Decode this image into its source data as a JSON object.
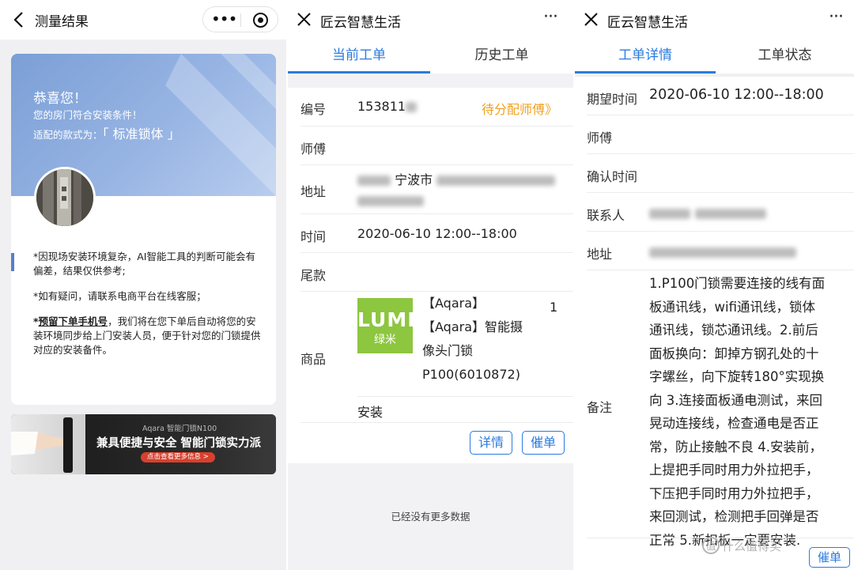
{
  "panel1": {
    "title": "测量结果",
    "congrats": "恭喜您！",
    "line1": "您的房门符合安装条件！",
    "line2_prefix": "适配的款式为：",
    "line2_value": "「 标准锁体 」",
    "note1": "*因现场安装环境复杂，AI智能工具的判断可能会有偏差，结果仅供参考;",
    "note2": "*如有疑问，请联系电商平台在线客服；",
    "note3_star": "*",
    "note3_link": "预留下单手机号",
    "note3_rest": "，我们将在您下单后自动将您的安装环境同步给上门安装人员，便于针对您的门锁提供对应的安装备件。",
    "banner_small": "Aqara 智能门锁N100",
    "banner_big": "兼具便捷与安全  智能门锁实力派",
    "banner_button": "点击查看更多信息 >"
  },
  "panel2": {
    "title": "匠云智慧生活",
    "tabs": [
      "当前工单",
      "历史工单"
    ],
    "labels": {
      "number": "编号",
      "master": "师傅",
      "address": "地址",
      "time": "时间",
      "balance": "尾款",
      "goods": "商品"
    },
    "number_value": "153811",
    "status": "待分配师傅》",
    "address_city": "宁波市",
    "time_value": "2020-06-10 12:00--18:00",
    "product_lines": [
      "【Aqara】",
      "【Aqara】智能摄",
      "像头门锁",
      "P100(6010872)"
    ],
    "product_qty": "1",
    "thumb_logo": "LUMI",
    "thumb_sub": "绿米",
    "service": "安装",
    "btn_detail": "详情",
    "btn_urge": "催单",
    "no_more": "已经没有更多数据"
  },
  "panel3": {
    "title": "匠云智慧生活",
    "tabs": [
      "工单详情",
      "工单状态"
    ],
    "labels": {
      "expected": "期望时间",
      "master": "师傅",
      "confirm": "确认时间",
      "contact": "联系人",
      "address": "地址",
      "remark": "备注"
    },
    "expected_value": "2020-06-10 12:00--18:00",
    "remark_lines": [
      "1.P100门锁需要连接的线有面",
      "板通讯线，wifi通讯线，锁体",
      "通讯线，锁芯通讯线。2.前后",
      "面板换向：卸掉方钢孔处的十",
      "字螺丝，向下旋转180°实现换",
      "向 3.连接面板通电测试，来回",
      "晃动连接线，检查通电是否正",
      "常，防止接触不良 4.安装前，",
      "上提把手同时用力外拉把手，",
      "下压把手同时用力外拉把手，",
      "来回测试，检测把手回弹是否",
      "正常 5.新扣板一定要安装."
    ],
    "watermark": "什么值得买",
    "btn_urge": "催单"
  },
  "colors": {
    "accent": "#2a7be0",
    "status_orange": "#f0a020",
    "lumi_green": "#8dc63f"
  }
}
